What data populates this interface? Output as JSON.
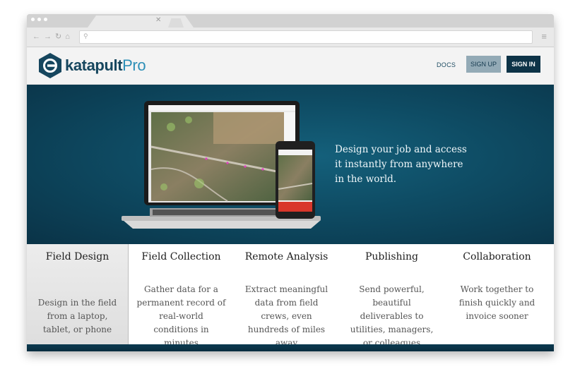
{
  "browser": {
    "icons": [
      "back-arrow-icon",
      "forward-arrow-icon",
      "reload-icon",
      "home-icon",
      "search-icon",
      "menu-icon"
    ]
  },
  "header": {
    "logo_text_main": "katapult",
    "logo_text_pro": "Pro",
    "nav": {
      "docs": "DOCS",
      "sign_up": "SIGN UP",
      "sign_in": "SIGN IN"
    }
  },
  "hero": {
    "headline_lines": [
      "Design your job and access",
      "it instantly from anywhere",
      "in the world."
    ]
  },
  "features": [
    {
      "title": "Field Design",
      "description": "Design in the field from a laptop, tablet, or phone",
      "active": true
    },
    {
      "title": "Field Collection",
      "description": "Gather data for a permanent record of real-world conditions in minutes",
      "active": false
    },
    {
      "title": "Remote Analysis",
      "description": "Extract meaningful data from field crews, even hundreds of miles away",
      "active": false
    },
    {
      "title": "Publishing",
      "description": "Send powerful, beautiful deliverables to utilities, managers, or colleagues",
      "active": false
    },
    {
      "title": "Collaboration",
      "description": "Work together to finish quickly and invoice sooner",
      "active": false
    }
  ],
  "colors": {
    "brand_dark": "#0d3347",
    "brand_light": "#2d8fb7",
    "signup_bg": "#93aab6",
    "hero_bg": "#0e4b63"
  }
}
